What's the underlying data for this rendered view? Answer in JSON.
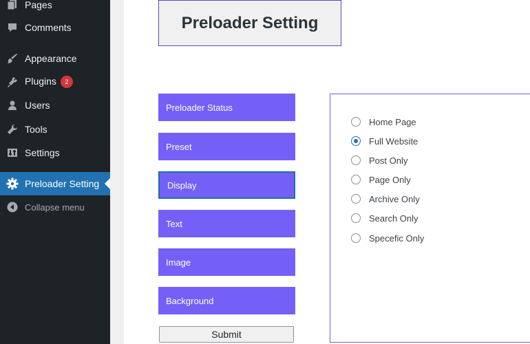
{
  "sidebar": {
    "items": [
      {
        "label": "Pages",
        "icon": "pages-icon"
      },
      {
        "label": "Comments",
        "icon": "comments-icon"
      },
      {
        "label": "Appearance",
        "icon": "appearance-icon"
      },
      {
        "label": "Plugins",
        "icon": "plugins-icon",
        "badge": "2"
      },
      {
        "label": "Users",
        "icon": "users-icon"
      },
      {
        "label": "Tools",
        "icon": "tools-icon"
      },
      {
        "label": "Settings",
        "icon": "settings-icon"
      },
      {
        "label": "Preloader Setting",
        "icon": "gear-icon",
        "active": true
      },
      {
        "label": "Collapse menu",
        "icon": "collapse-icon"
      }
    ]
  },
  "page": {
    "title": "Preloader Setting"
  },
  "tabs": [
    {
      "label": "Preloader Status"
    },
    {
      "label": "Preset"
    },
    {
      "label": "Display",
      "selected": true
    },
    {
      "label": "Text"
    },
    {
      "label": "Image"
    },
    {
      "label": "Background"
    }
  ],
  "submit_label": "Submit",
  "display_options": [
    {
      "label": "Home Page",
      "checked": false
    },
    {
      "label": "Full Website",
      "checked": true
    },
    {
      "label": "Post Only",
      "checked": false
    },
    {
      "label": "Page Only",
      "checked": false
    },
    {
      "label": "Archive Only",
      "checked": false
    },
    {
      "label": "Search Only",
      "checked": false
    },
    {
      "label": "Specefic Only",
      "checked": false
    }
  ],
  "colors": {
    "sidebar_bg": "#1d2327",
    "active_menu": "#2271b1",
    "tab_bg": "#7460f7",
    "badge": "#d63638"
  }
}
